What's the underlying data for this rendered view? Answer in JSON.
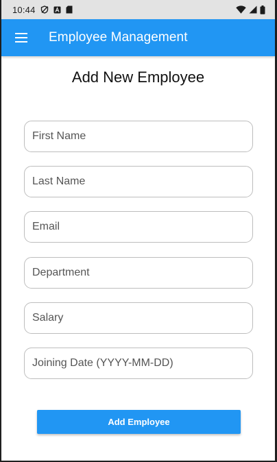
{
  "status_bar": {
    "time": "10:44",
    "icons": [
      "vpn-icon",
      "a-icon",
      "sd-card-icon",
      "wifi-icon",
      "signal-icon",
      "battery-icon"
    ]
  },
  "app_bar": {
    "title": "Employee Management",
    "menu_icon": "menu-icon",
    "color": "#2196f3"
  },
  "form": {
    "heading": "Add New Employee",
    "fields": {
      "first_name": {
        "placeholder": "First Name",
        "value": ""
      },
      "last_name": {
        "placeholder": "Last Name",
        "value": ""
      },
      "email": {
        "placeholder": "Email",
        "value": ""
      },
      "department": {
        "placeholder": "Department",
        "value": ""
      },
      "salary": {
        "placeholder": "Salary",
        "value": ""
      },
      "joining_date": {
        "placeholder": "Joining Date (YYYY-MM-DD)",
        "value": ""
      }
    },
    "submit_label": "Add Employee",
    "accent_color": "#2196f3"
  }
}
